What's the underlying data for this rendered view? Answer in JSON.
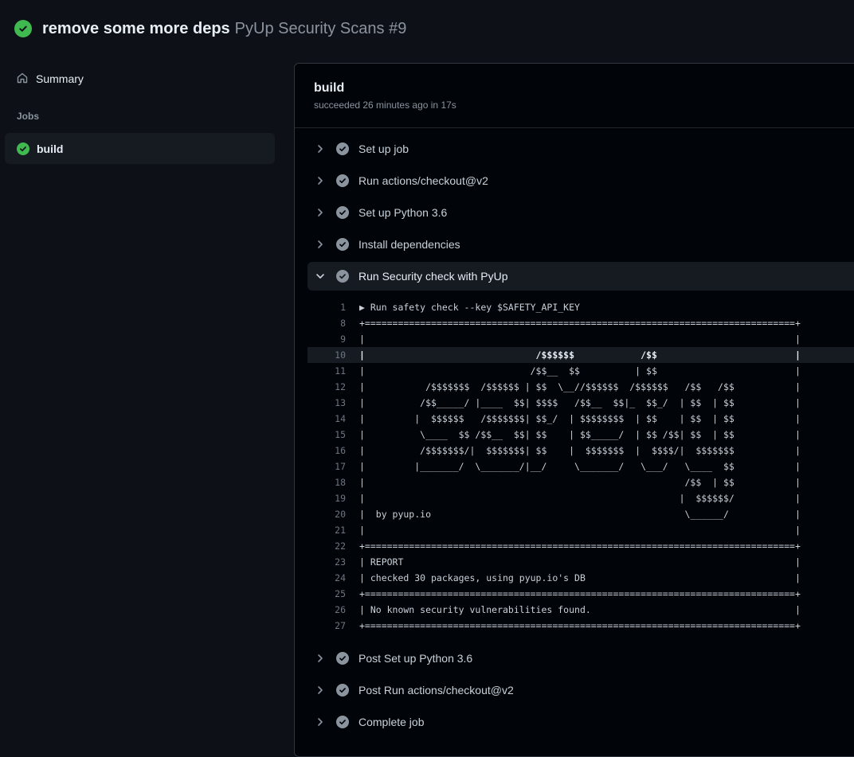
{
  "header": {
    "title": "remove some more deps",
    "subtitle": "PyUp Security Scans #9"
  },
  "sidebar": {
    "summary_label": "Summary",
    "jobs_heading": "Jobs",
    "job_label": "build"
  },
  "job": {
    "title": "build",
    "meta": "succeeded 26 minutes ago in 17s"
  },
  "steps_before": [
    "Set up job",
    "Run actions/checkout@v2",
    "Set up Python 3.6",
    "Install dependencies"
  ],
  "expanded_step": "Run Security check with PyUp",
  "log": [
    {
      "n": "1",
      "t": "▶ Run safety check --key $SAFETY_API_KEY"
    },
    {
      "n": "8",
      "t": "+==============================================================================+"
    },
    {
      "n": "9",
      "t": "|                                                                              |"
    },
    {
      "n": "10",
      "t": "|                               /$$$$$$            /$$                         |",
      "hl": true
    },
    {
      "n": "11",
      "t": "|                              /$$__  $$          | $$                         |"
    },
    {
      "n": "12",
      "t": "|           /$$$$$$$  /$$$$$$ | $$  \\__//$$$$$$  /$$$$$$   /$$   /$$           |"
    },
    {
      "n": "13",
      "t": "|          /$$_____/ |____  $$| $$$$   /$$__  $$|_  $$_/  | $$  | $$           |"
    },
    {
      "n": "14",
      "t": "|         |  $$$$$$   /$$$$$$$| $$_/  | $$$$$$$$  | $$    | $$  | $$           |"
    },
    {
      "n": "15",
      "t": "|          \\____  $$ /$$__  $$| $$    | $$_____/  | $$ /$$| $$  | $$           |"
    },
    {
      "n": "16",
      "t": "|          /$$$$$$$/|  $$$$$$$| $$    |  $$$$$$$  |  $$$$/|  $$$$$$$           |"
    },
    {
      "n": "17",
      "t": "|         |_______/  \\_______/|__/     \\_______/   \\___/   \\____  $$           |"
    },
    {
      "n": "18",
      "t": "|                                                          /$$  | $$           |"
    },
    {
      "n": "19",
      "t": "|                                                         |  $$$$$$/           |"
    },
    {
      "n": "20",
      "t": "|  by pyup.io                                              \\______/            |"
    },
    {
      "n": "21",
      "t": "|                                                                              |"
    },
    {
      "n": "22",
      "t": "+==============================================================================+"
    },
    {
      "n": "23",
      "t": "| REPORT                                                                       |"
    },
    {
      "n": "24",
      "t": "| checked 30 packages, using pyup.io's DB                                      |"
    },
    {
      "n": "25",
      "t": "+==============================================================================+"
    },
    {
      "n": "26",
      "t": "| No known security vulnerabilities found.                                     |"
    },
    {
      "n": "27",
      "t": "+==============================================================================+"
    }
  ],
  "steps_after": [
    "Post Set up Python 3.6",
    "Post Run actions/checkout@v2",
    "Complete job"
  ],
  "colors": {
    "success": "#3fb950",
    "background": "#0d1117",
    "panel": "#010409",
    "muted": "#8b949e"
  },
  "icons": {
    "status": "check-circle-icon",
    "summary": "home-icon",
    "collapsed": "chevron-right-icon",
    "expanded": "chevron-down-icon"
  }
}
